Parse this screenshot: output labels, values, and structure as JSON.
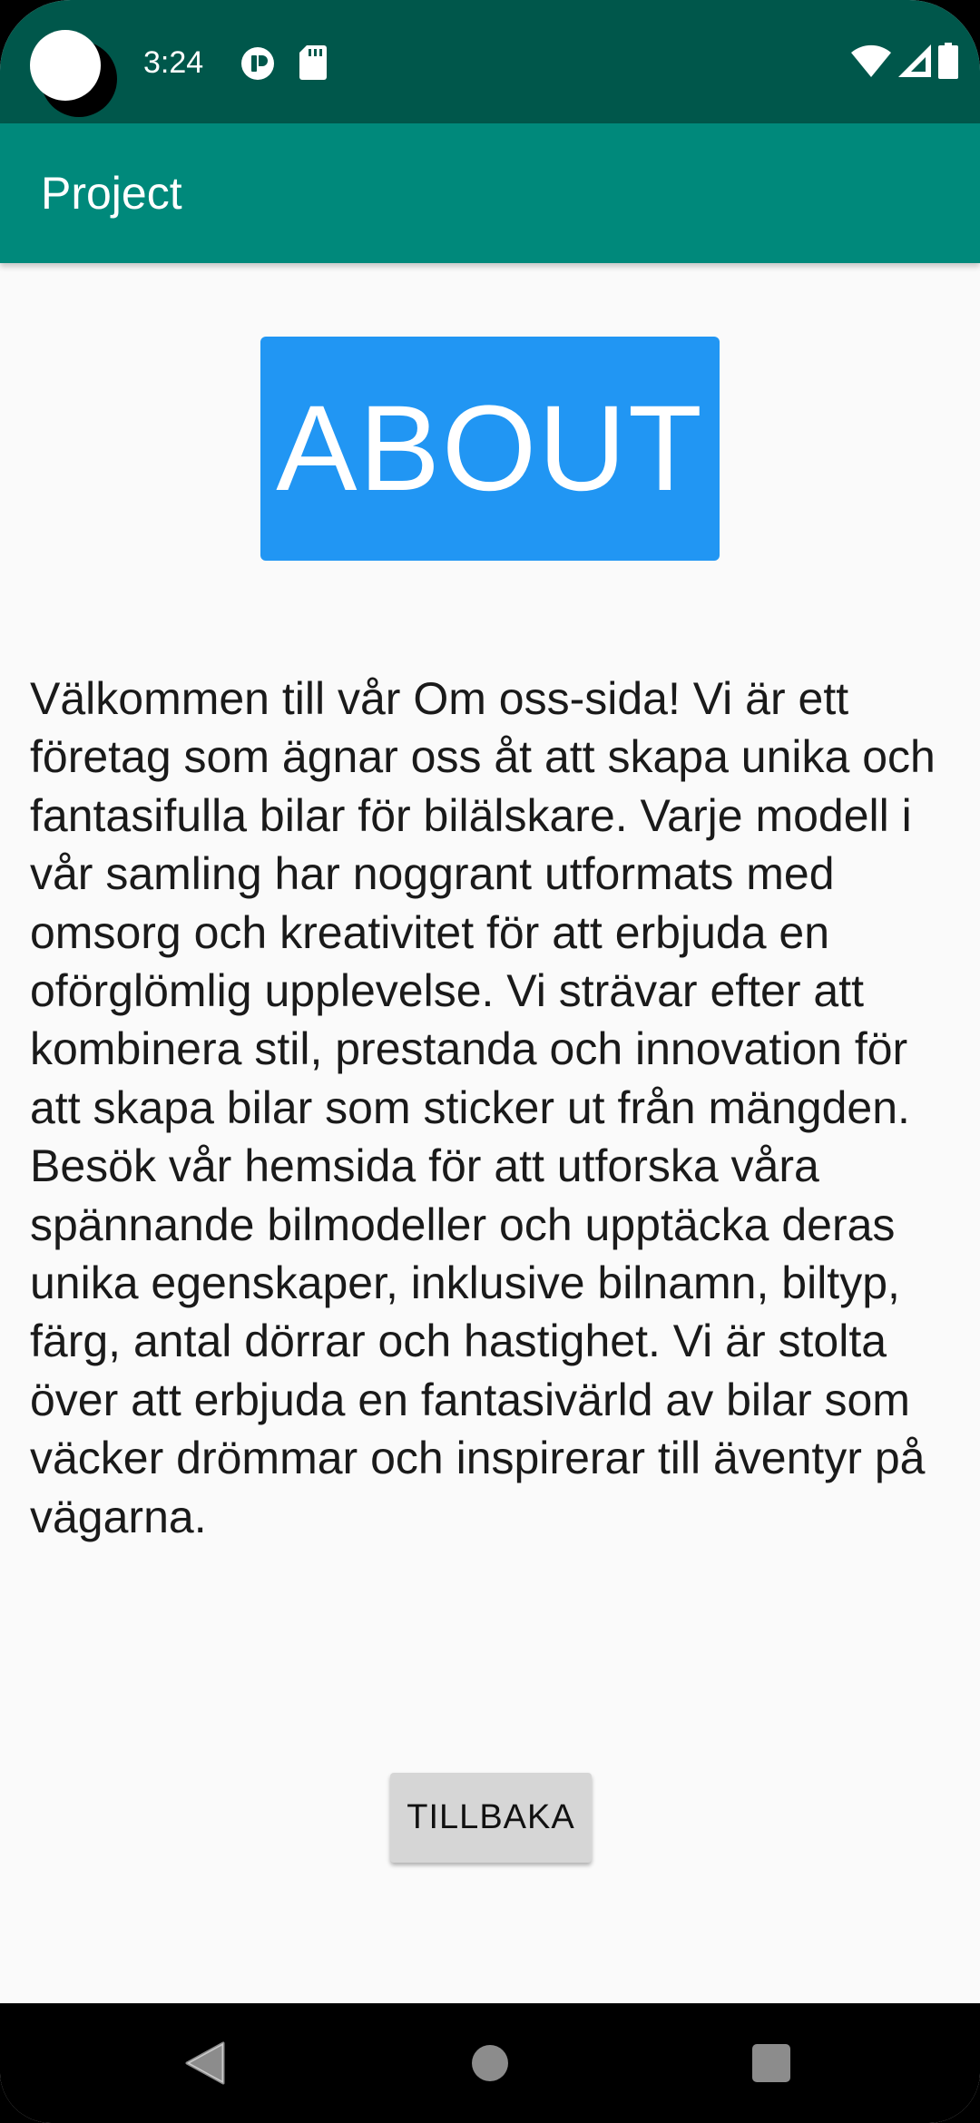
{
  "status_bar": {
    "time": "3:24",
    "left_icons": [
      "hotspot-icon",
      "sd-card-icon"
    ],
    "right_icons": [
      "wifi-icon",
      "cell-signal-icon",
      "battery-icon"
    ]
  },
  "app_bar": {
    "title": "Project"
  },
  "main": {
    "heading": "ABOUT",
    "body": "Välkommen till vår Om oss-sida! Vi är ett företag som ägnar oss åt att skapa unika och fantasifulla bilar för bilälskare. Varje modell i vår samling har noggrant utformats med omsorg och kreativitet för att erbjuda en oförglömlig upplevelse. Vi strävar efter att kombinera stil, prestanda och innovation för att skapa bilar som sticker ut från mängden. Besök vår hemsida för att utforska våra spännande bilmodeller och upptäcka deras unika egenskaper, inklusive bilnamn, biltyp, färg, antal dörrar och hastighet. Vi är stolta över att erbjuda en fantasivärld av bilar som väcker drömmar och inspirerar till äventyr på vägarna.",
    "back_button_label": "TILLBAKA"
  },
  "nav_bar": {
    "buttons": [
      "back-icon",
      "home-icon",
      "recents-icon"
    ]
  },
  "colors": {
    "status_bar": "#00574b",
    "app_bar": "#00897b",
    "about_box": "#2196f3",
    "background": "#fafafa",
    "button": "#d6d6d6"
  }
}
